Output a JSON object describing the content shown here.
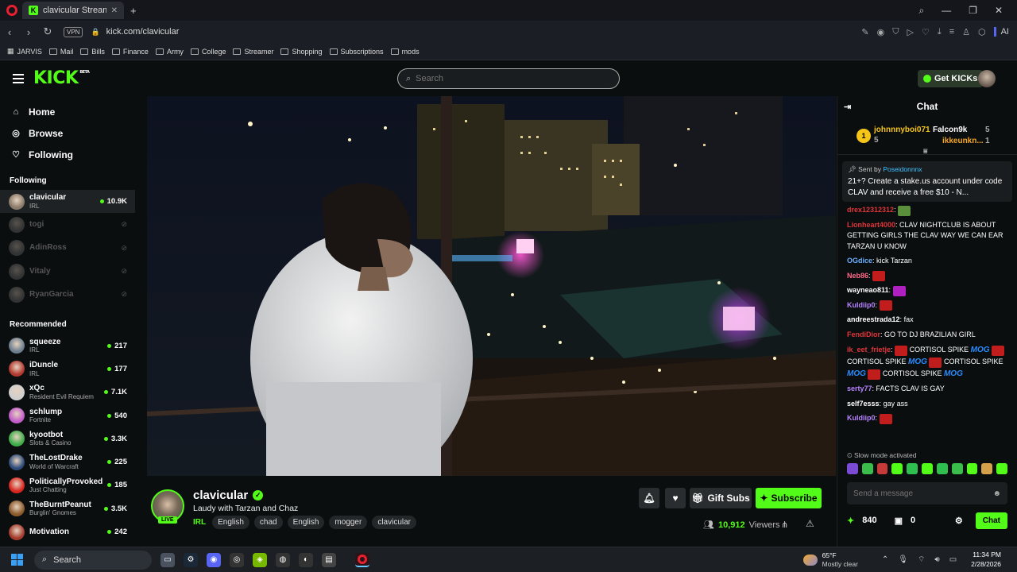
{
  "browser": {
    "tab_title": "clavicular Stream - Wa",
    "new_tab": "+",
    "url": "kick.com/clavicular",
    "vpn_label": "VPN",
    "ai_label": "AI",
    "bookmarks": [
      "JARVIS",
      "Mail",
      "Bills",
      "Finance",
      "Army",
      "College",
      "Streamer",
      "Shopping",
      "Subscriptions",
      "mods"
    ]
  },
  "header": {
    "logo": "KICK",
    "logo_badge": "BETA",
    "search_placeholder": "Search",
    "get_kicks": "Get KICKs"
  },
  "sidebar": {
    "nav": [
      {
        "label": "Home",
        "icon": "home-icon"
      },
      {
        "label": "Browse",
        "icon": "compass-icon"
      },
      {
        "label": "Following",
        "icon": "heart-icon"
      }
    ],
    "following_title": "Following",
    "following": [
      {
        "name": "clavicular",
        "category": "IRL",
        "viewers": "10.9K",
        "live": true,
        "color": "#8a7a6a"
      },
      {
        "name": "togi",
        "category": "",
        "viewers": "",
        "live": false,
        "color": "#777"
      },
      {
        "name": "AdinRoss",
        "category": "",
        "viewers": "",
        "live": false,
        "color": "#777"
      },
      {
        "name": "Vitaly",
        "category": "",
        "viewers": "",
        "live": false,
        "color": "#777"
      },
      {
        "name": "RyanGarcia",
        "category": "",
        "viewers": "",
        "live": false,
        "color": "#777"
      }
    ],
    "recommended_title": "Recommended",
    "recommended": [
      {
        "name": "squeeze",
        "category": "IRL",
        "viewers": "217",
        "color": "#6d7f8e"
      },
      {
        "name": "iDuncle",
        "category": "IRL",
        "viewers": "177",
        "color": "#b2392f"
      },
      {
        "name": "xQc",
        "category": "Resident Evil Requiem",
        "viewers": "7.1K",
        "color": "#cfcfcf"
      },
      {
        "name": "schlump",
        "category": "Fortnite",
        "viewers": "540",
        "color": "#c25ec9"
      },
      {
        "name": "kyootbot",
        "category": "Slots & Casino",
        "viewers": "3.3K",
        "color": "#3fae4a"
      },
      {
        "name": "TheLostDrake",
        "category": "World of Warcraft",
        "viewers": "225",
        "color": "#2d4b7a"
      },
      {
        "name": "PoliticallyProvoked",
        "category": "Just Chatting",
        "viewers": "185",
        "color": "#d8261f"
      },
      {
        "name": "TheBurntPeanut",
        "category": "Burglin' Gnomes",
        "viewers": "3.5K",
        "color": "#8b5a2b"
      },
      {
        "name": "Motivation",
        "category": "",
        "viewers": "242",
        "color": "#a33b2c"
      }
    ]
  },
  "stream": {
    "streamer": "clavicular",
    "live_badge": "LIVE",
    "title": "Laudy with Tarzan and Chaz",
    "category": "IRL",
    "tags": [
      "English",
      "chad",
      "English",
      "mogger",
      "clavicular"
    ],
    "gift_label": "Gift Subs",
    "subscribe_label": "Subscribe",
    "viewers": "10,912",
    "viewers_label": "Viewers"
  },
  "chat": {
    "title": "Chat",
    "gifters": [
      {
        "rank": "1",
        "name": "johnnnyboi071",
        "count": "5"
      },
      {
        "name": "Falcon9k",
        "count": "5"
      },
      {
        "name": "ikkeunkn...",
        "count": "1"
      }
    ],
    "pinned_sent_by": "Sent by",
    "pinned_user": "Poseidonnnx",
    "pinned_text": "21+? Create a stake.us account under code CLAV and receive a free $10 - N...",
    "messages": [
      {
        "user": "drex12312312",
        "color": "#e0363a",
        "text": ""
      },
      {
        "user": "Lionheart4000",
        "color": "#e0363a",
        "text": "CLAV NIGHTCLUB IS ABOUT GETTING GIRLS THE CLAV WAY WE CAN EAR TARZAN U KNOW"
      },
      {
        "user": "OGdice",
        "color": "#6ab0ff",
        "text": "kick Tarzan"
      },
      {
        "user": "Neb86",
        "color": "#ff6b8a",
        "text": ""
      },
      {
        "user": "wayneao811",
        "color": "#ffffff",
        "text": ""
      },
      {
        "user": "Kuldiip0",
        "color": "#b784ff",
        "text": ""
      },
      {
        "user": "andreestrada12",
        "color": "#ffffff",
        "text": "fax"
      },
      {
        "user": "FendiDior",
        "color": "#e0363a",
        "text": "GO TO DJ BRAZILIAN GIRL"
      },
      {
        "user": "ik_eet_frietje",
        "color": "#e0363a",
        "text": "CORTISOL SPIKE",
        "repeat": "CORTISOL SPIKE"
      },
      {
        "user": "serty77",
        "color": "#b784ff",
        "text": "FACTS CLAV IS GAY"
      },
      {
        "user": "self7esss",
        "color": "#ffffff",
        "text": "gay ass"
      },
      {
        "user": "Kuldiip0",
        "color": "#b784ff",
        "text": ""
      }
    ],
    "mog_text": "MOG",
    "slow_mode": "Slow mode activated",
    "input_placeholder": "Send a message",
    "points": "840",
    "gift_count": "0",
    "chat_button": "Chat"
  },
  "taskbar": {
    "search_label": "Search",
    "temperature": "65°F",
    "weather": "Mostly clear",
    "time": "11:34 PM",
    "date": "2/28/2026"
  }
}
